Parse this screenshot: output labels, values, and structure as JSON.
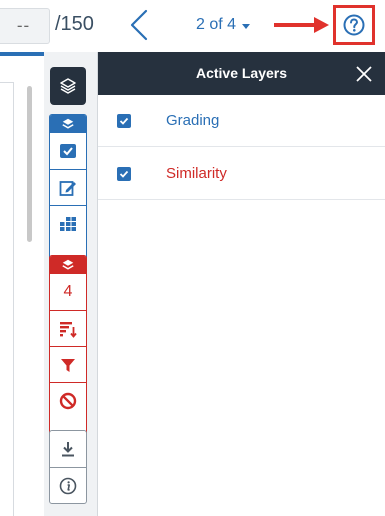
{
  "header": {
    "grade_value": "--",
    "grade_total": "/150",
    "page_label": "2 of 4"
  },
  "panel": {
    "title": "Active Layers",
    "layers": [
      {
        "label": "Grading",
        "checked": true,
        "color": "#2a6fb5"
      },
      {
        "label": "Similarity",
        "checked": true,
        "color": "#cf2a27"
      }
    ]
  },
  "toolbar": {
    "similarity_count": "4"
  },
  "colors": {
    "accent_blue": "#2a6fb5",
    "accent_red": "#cf2a27",
    "dark_header": "#26313e",
    "highlight_red": "#e0322c"
  },
  "icons": {
    "prev": "chevron-left-icon",
    "help": "help-icon",
    "close": "close-icon",
    "layers": "layers-icon",
    "checkbox": "check-icon",
    "edit": "edit-icon",
    "rubric": "grid-icon",
    "sort": "sort-icon",
    "filter": "filter-icon",
    "exclude": "ban-icon",
    "download": "download-icon",
    "info": "info-icon"
  }
}
